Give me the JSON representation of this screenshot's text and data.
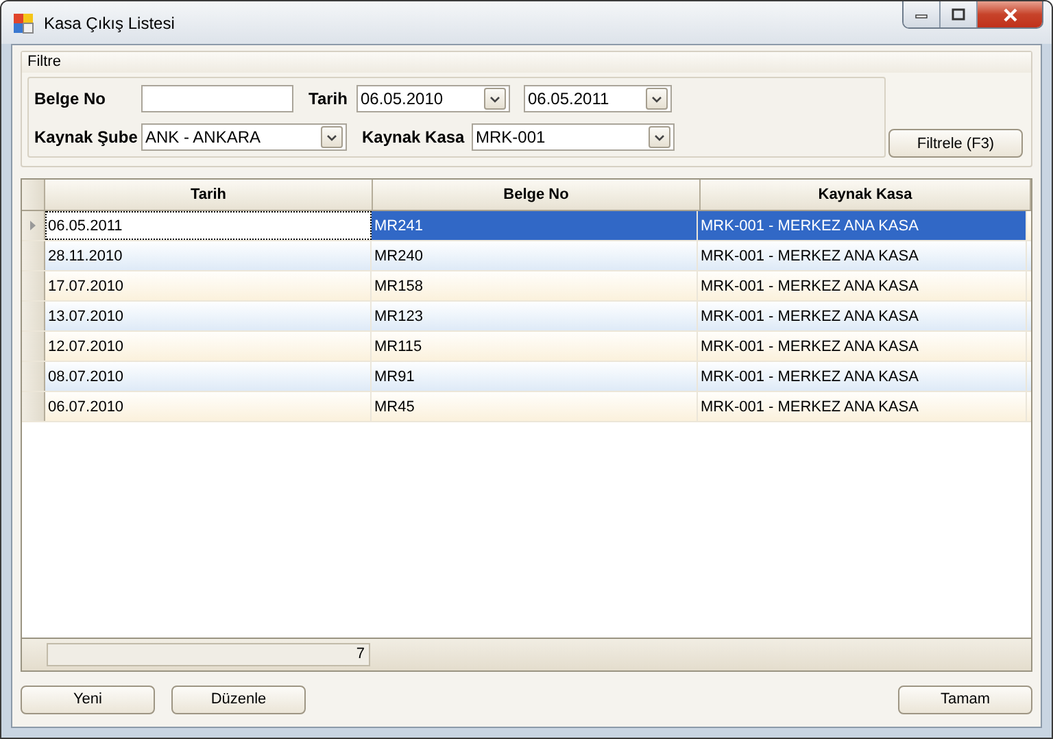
{
  "window": {
    "title": "Kasa Çıkış Listesi"
  },
  "filter": {
    "title": "Filtre",
    "belge_no": {
      "label": "Belge No"
    },
    "tarih": {
      "label": "Tarih",
      "from": "06.05.2010",
      "to": "06.05.2011"
    },
    "kaynak_sube": {
      "label": "Kaynak Şube",
      "value": "ANK - ANKARA"
    },
    "kaynak_kasa": {
      "label": "Kaynak Kasa",
      "value": "MRK-001"
    },
    "button": "Filtrele (F3)"
  },
  "table": {
    "columns": [
      "Tarih",
      "Belge No",
      "Kaynak Kasa"
    ],
    "rows": [
      {
        "cells": [
          "06.05.2011",
          "MR241",
          "MRK-001 - MERKEZ ANA KASA"
        ],
        "selected": true
      },
      {
        "cells": [
          "28.11.2010",
          "MR240",
          "MRK-001 - MERKEZ ANA KASA"
        ],
        "selected": false
      },
      {
        "cells": [
          "17.07.2010",
          "MR158",
          "MRK-001 - MERKEZ ANA KASA"
        ],
        "selected": false
      },
      {
        "cells": [
          "13.07.2010",
          "MR123",
          "MRK-001 - MERKEZ ANA KASA"
        ],
        "selected": false
      },
      {
        "cells": [
          "12.07.2010",
          "MR115",
          "MRK-001 - MERKEZ ANA KASA"
        ],
        "selected": false
      },
      {
        "cells": [
          "08.07.2010",
          "MR91",
          "MRK-001 - MERKEZ ANA KASA"
        ],
        "selected": false
      },
      {
        "cells": [
          "06.07.2010",
          "MR45",
          "MRK-001 - MERKEZ ANA KASA"
        ],
        "selected": false
      }
    ],
    "count": "7"
  },
  "buttons_left": [
    "Yeni",
    "Düzenle"
  ],
  "buttons_right": [
    "Tamam"
  ]
}
